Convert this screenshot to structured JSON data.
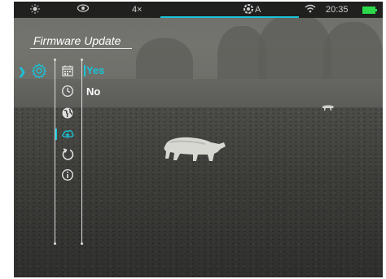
{
  "status_bar": {
    "zoom": "4×",
    "mode": "A",
    "time": "20:35"
  },
  "menu": {
    "title": "Firmware Update",
    "options": [
      {
        "label": "Yes",
        "selected": true,
        "color": "#19c3d6"
      },
      {
        "label": "No",
        "selected": false,
        "color": "#ffffff"
      }
    ],
    "icons": [
      "calendar-icon",
      "clock-icon",
      "globe-icon",
      "cloud-upload-icon",
      "reset-icon",
      "info-icon"
    ],
    "active_icon": "cloud-upload-icon"
  },
  "colors": {
    "accent": "#19c3d6",
    "battery": "#2bd94a"
  }
}
